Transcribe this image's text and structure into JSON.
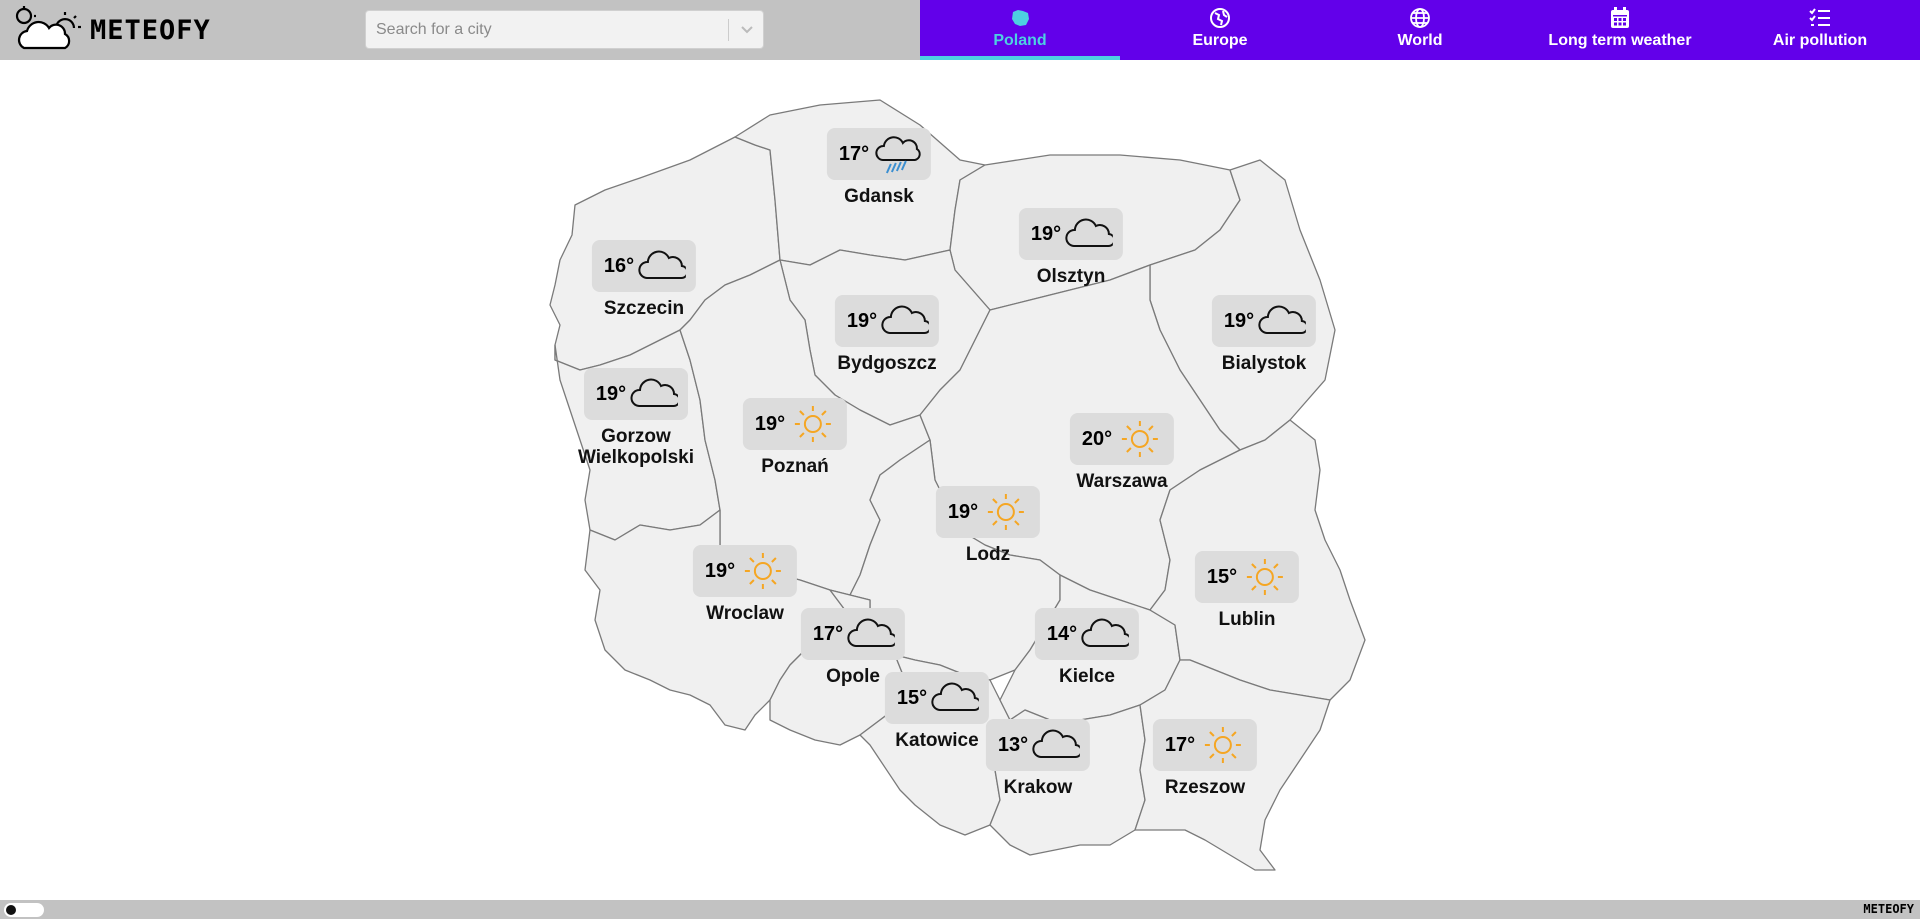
{
  "app": {
    "name": "METEOFY"
  },
  "search": {
    "placeholder": "Search for a city"
  },
  "nav": {
    "tabs": [
      {
        "label": "Poland",
        "icon": "poland-map-icon",
        "active": true
      },
      {
        "label": "Europe",
        "icon": "europe-globe-icon",
        "active": false
      },
      {
        "label": "World",
        "icon": "world-globe-icon",
        "active": false
      },
      {
        "label": "Long term weather",
        "icon": "calendar-icon",
        "active": false
      },
      {
        "label": "Air pollution",
        "icon": "checklist-icon",
        "active": false
      }
    ]
  },
  "colors": {
    "nav_bg": "#6200ea",
    "active_accent": "#4dd0e1",
    "sun": "#f5a623",
    "rain": "#3b8fd1",
    "region_fill": "#f0f0f0"
  },
  "cities": [
    {
      "name": "Gdansk",
      "temp": "17°",
      "icon": "rain-cloud-icon"
    },
    {
      "name": "Szczecin",
      "temp": "16°",
      "icon": "cloud-icon"
    },
    {
      "name": "Olsztyn",
      "temp": "19°",
      "icon": "cloud-icon"
    },
    {
      "name": "Bydgoszcz",
      "temp": "19°",
      "icon": "cloud-icon"
    },
    {
      "name": "Bialystok",
      "temp": "19°",
      "icon": "cloud-icon"
    },
    {
      "name": "Gorzow\nWielkopolski",
      "temp": "19°",
      "icon": "cloud-icon"
    },
    {
      "name": "Poznań",
      "temp": "19°",
      "icon": "sun-icon"
    },
    {
      "name": "Warszawa",
      "temp": "20°",
      "icon": "sun-icon"
    },
    {
      "name": "Lodz",
      "temp": "19°",
      "icon": "sun-icon"
    },
    {
      "name": "Wroclaw",
      "temp": "19°",
      "icon": "sun-icon"
    },
    {
      "name": "Lublin",
      "temp": "15°",
      "icon": "sun-icon"
    },
    {
      "name": "Opole",
      "temp": "17°",
      "icon": "cloud-icon"
    },
    {
      "name": "Kielce",
      "temp": "14°",
      "icon": "cloud-icon"
    },
    {
      "name": "Katowice",
      "temp": "15°",
      "icon": "cloud-icon"
    },
    {
      "name": "Krakow",
      "temp": "13°",
      "icon": "cloud-icon"
    },
    {
      "name": "Rzeszow",
      "temp": "17°",
      "icon": "sun-icon"
    }
  ],
  "footer": {
    "brand": "METEOFY"
  }
}
